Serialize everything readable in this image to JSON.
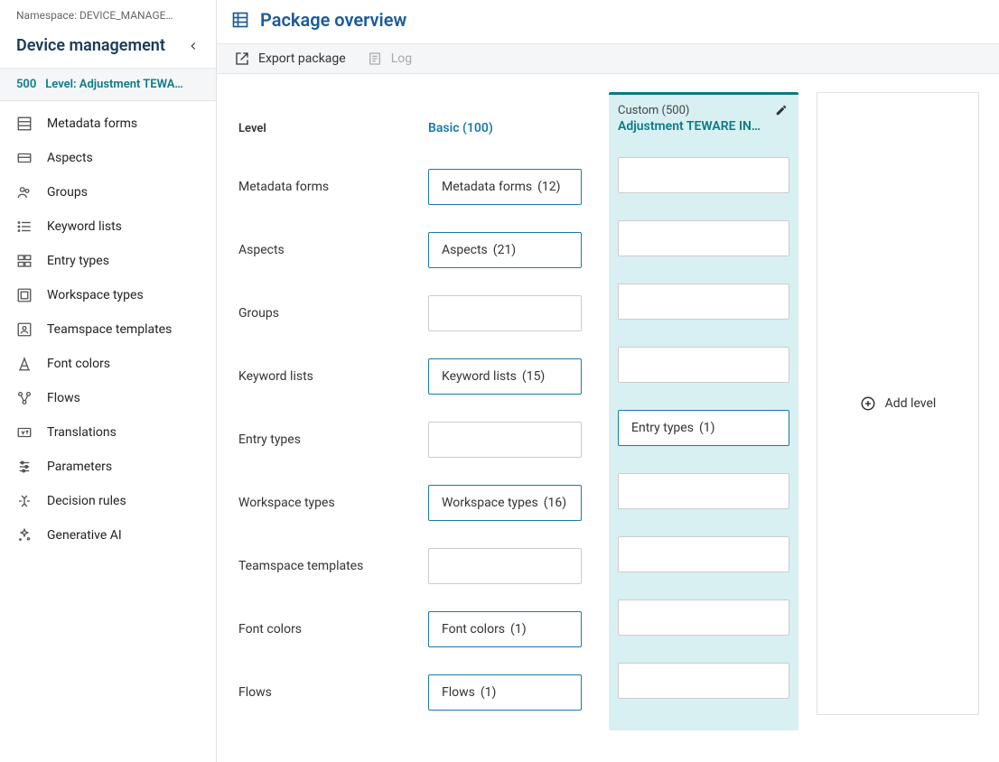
{
  "namespace": "Namespace: DEVICE_MANAGE…",
  "appTitle": "Device management",
  "levelBar": {
    "num": "500",
    "label": "Level: Adjustment TEWA…"
  },
  "nav": [
    {
      "icon": "table",
      "label": "Metadata forms"
    },
    {
      "icon": "card",
      "label": "Aspects"
    },
    {
      "icon": "group",
      "label": "Groups"
    },
    {
      "icon": "list",
      "label": "Keyword lists"
    },
    {
      "icon": "entry",
      "label": "Entry types"
    },
    {
      "icon": "workspace",
      "label": "Workspace types"
    },
    {
      "icon": "teamspace",
      "label": "Teamspace templates"
    },
    {
      "icon": "font",
      "label": "Font colors"
    },
    {
      "icon": "flow",
      "label": "Flows"
    },
    {
      "icon": "translate",
      "label": "Translations"
    },
    {
      "icon": "param",
      "label": "Parameters"
    },
    {
      "icon": "decision",
      "label": "Decision rules"
    },
    {
      "icon": "ai",
      "label": "Generative AI"
    }
  ],
  "pageTitle": "Package overview",
  "toolbar": {
    "export": "Export package",
    "log": "Log"
  },
  "columns": {
    "levelHeader": "Level",
    "basicHeader": "Basic (100)",
    "customSub": "Custom (500)",
    "customName": "Adjustment TEWARE IN…",
    "addLabel": "Add level"
  },
  "rows": [
    {
      "label": "Metadata forms",
      "basic": {
        "text": "Metadata forms",
        "count": "(12)"
      },
      "custom": null
    },
    {
      "label": "Aspects",
      "basic": {
        "text": "Aspects",
        "count": "(21)"
      },
      "custom": null
    },
    {
      "label": "Groups",
      "basic": null,
      "custom": null
    },
    {
      "label": "Keyword lists",
      "basic": {
        "text": "Keyword lists",
        "count": "(15)"
      },
      "custom": null
    },
    {
      "label": "Entry types",
      "basic": null,
      "custom": {
        "text": "Entry types",
        "count": "(1)"
      }
    },
    {
      "label": "Workspace types",
      "basic": {
        "text": "Workspace types",
        "count": "(16)"
      },
      "custom": null
    },
    {
      "label": "Teamspace templates",
      "basic": null,
      "custom": null
    },
    {
      "label": "Font colors",
      "basic": {
        "text": "Font colors",
        "count": "(1)"
      },
      "custom": null
    },
    {
      "label": "Flows",
      "basic": {
        "text": "Flows",
        "count": "(1)"
      },
      "custom": null
    }
  ]
}
